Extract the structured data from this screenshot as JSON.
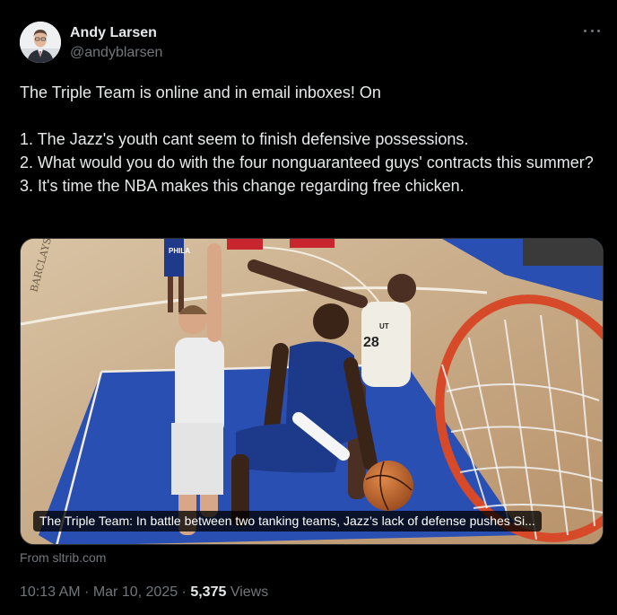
{
  "author": {
    "name": "Andy Larsen",
    "handle": "@andyblarsen",
    "avatar_icon": "user-avatar-photo"
  },
  "tweet": {
    "lines": [
      "The Triple Team is online and in email inboxes! On",
      "1. The Jazz's youth cant seem to finish defensive possessions.",
      "2. What would you do with the four nonguaranteed guys' contracts this summer?",
      "3. It's time the NBA makes this change regarding free chicken."
    ]
  },
  "link_card": {
    "caption": "The Triple Team: In battle between two tanking teams, Jazz’s lack of defense pushes Si...",
    "source": "From sltrib.com",
    "image": {
      "court_text": "BARCLAYS CENTER",
      "jersey_numbers": [
        "28",
        "28"
      ],
      "jersey_brands": [
        "PHILA",
        "UT"
      ]
    }
  },
  "meta": {
    "time": "10:13 AM",
    "separator1": " · ",
    "date": "Mar 10, 2025",
    "separator2": " · ",
    "views_count": "5,375",
    "views_label": " Views"
  },
  "colors": {
    "background": "#000000",
    "text_primary": "#e7e9ea",
    "text_secondary": "#71767b",
    "border": "#2f3336"
  }
}
